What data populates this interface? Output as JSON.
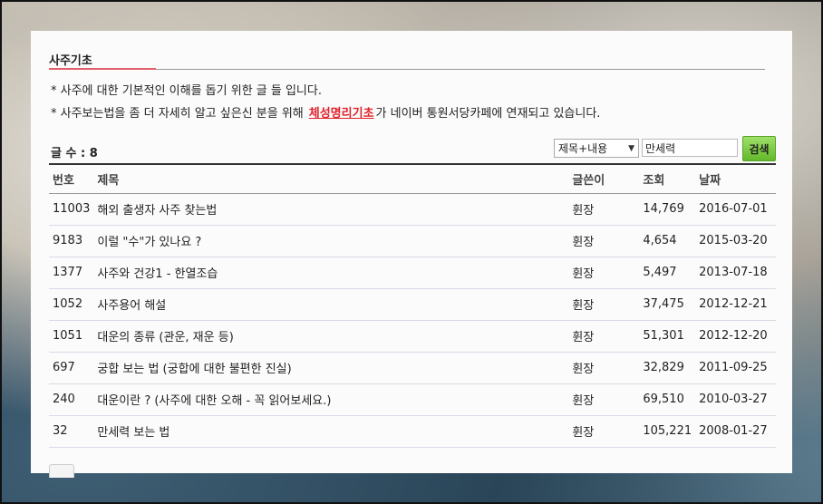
{
  "board": {
    "section_title": "사주기초",
    "notice_1": "* 사주에 대한 기본적인 이해를 돕기 위한 글 들 입니다.",
    "notice_2_prefix": "* 사주보는법을 좀 더 자세히 알고 싶은신 분을 위해",
    "notice_2_link": "체성명리기초",
    "notice_2_suffix": "가 네이버 통원서당카페에 연재되고 있습니다.",
    "count_label": "글 수 : 8"
  },
  "search": {
    "select_value": "제목+내용",
    "input_value": "만세력",
    "button_label": "검색"
  },
  "table": {
    "headers": [
      "번호",
      "제목",
      "글쓴이",
      "조회",
      "날짜"
    ],
    "rows": [
      {
        "no": "11003",
        "title": "해외 출생자 사주 찾는법",
        "writer": "휜장",
        "views": "14,769",
        "date": "2016-07-01"
      },
      {
        "no": "9183",
        "title": "이럴 \"수\"가 있나요 ?",
        "writer": "휜장",
        "views": "4,654",
        "date": "2015-03-20"
      },
      {
        "no": "1377",
        "title": "사주와 건강1 - 한열조습",
        "writer": "휜장",
        "views": "5,497",
        "date": "2013-07-18"
      },
      {
        "no": "1052",
        "title": "사주용어 해설",
        "writer": "휜장",
        "views": "37,475",
        "date": "2012-12-21"
      },
      {
        "no": "1051",
        "title": "대운의 종류 (관운, 재운 등)",
        "writer": "휜장",
        "views": "51,301",
        "date": "2012-12-20"
      },
      {
        "no": "697",
        "title": "궁합 보는 법 (궁합에 대한 불편한 진실)",
        "writer": "휜장",
        "views": "32,829",
        "date": "2011-09-25"
      },
      {
        "no": "240",
        "title": "대운이란 ? (사주에 대한 오해 - 꼭 읽어보세요.)",
        "writer": "휜장",
        "views": "69,510",
        "date": "2010-03-27"
      },
      {
        "no": "32",
        "title": "만세력 보는 법",
        "writer": "휜장",
        "views": "105,221",
        "date": "2008-01-27"
      }
    ]
  },
  "colors": {
    "accent_red": "#e0222a",
    "search_green": "#62b92a"
  }
}
